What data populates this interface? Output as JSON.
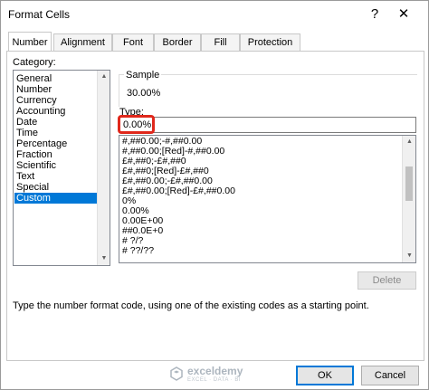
{
  "window": {
    "title": "Format Cells",
    "help_label": "?",
    "close_label": "✕"
  },
  "tabs": [
    {
      "label": "Number",
      "active": true
    },
    {
      "label": "Alignment",
      "active": false
    },
    {
      "label": "Font",
      "active": false
    },
    {
      "label": "Border",
      "active": false
    },
    {
      "label": "Fill",
      "active": false
    },
    {
      "label": "Protection",
      "active": false
    }
  ],
  "category": {
    "label": "Category:",
    "items": [
      "General",
      "Number",
      "Currency",
      "Accounting",
      "Date",
      "Time",
      "Percentage",
      "Fraction",
      "Scientific",
      "Text",
      "Special",
      "Custom"
    ],
    "selected": "Custom"
  },
  "sample": {
    "label": "Sample",
    "value": "30.00%"
  },
  "type": {
    "label": "Type:",
    "value": "0.00%",
    "formats": [
      "#,##0.00;-#,##0.00",
      "#,##0.00;[Red]-#,##0.00",
      "£#,##0;-£#,##0",
      "£#,##0;[Red]-£#,##0",
      "£#,##0.00;-£#,##0.00",
      "£#,##0.00;[Red]-£#,##0.00",
      "0%",
      "0.00%",
      "0.00E+00",
      "##0.0E+0",
      "# ?/?",
      "# ??/??"
    ]
  },
  "buttons": {
    "delete": "Delete",
    "ok": "OK",
    "cancel": "Cancel"
  },
  "hint": "Type the number format code, using one of the existing codes as a starting point.",
  "watermark": {
    "name": "exceldemy",
    "tagline": "EXCEL · DATA · BI"
  },
  "colors": {
    "accent": "#0078d7",
    "highlight": "#e0281c"
  }
}
